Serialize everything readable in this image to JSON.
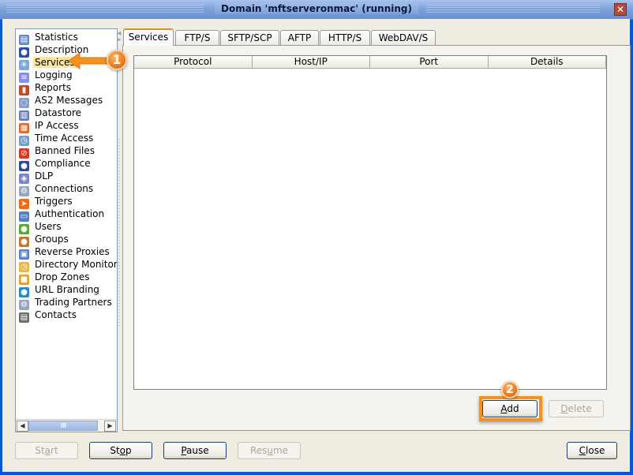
{
  "window": {
    "title": "Domain 'mftserveronmac' (running)",
    "close_icon": "close-icon"
  },
  "sidebar": {
    "selected": "Services",
    "items": [
      {
        "label": "Statistics",
        "icon": "statistics-icon"
      },
      {
        "label": "Description",
        "icon": "person-icon"
      },
      {
        "label": "Services",
        "icon": "services-icon"
      },
      {
        "label": "Logging",
        "icon": "speech-bubble-icon"
      },
      {
        "label": "Reports",
        "icon": "bar-chart-icon"
      },
      {
        "label": "AS2 Messages",
        "icon": "messages-icon"
      },
      {
        "label": "Datastore",
        "icon": "database-icon"
      },
      {
        "label": "IP Access",
        "icon": "firewall-icon"
      },
      {
        "label": "Time Access",
        "icon": "calendar-clock-icon"
      },
      {
        "label": "Banned Files",
        "icon": "banned-file-icon"
      },
      {
        "label": "Compliance",
        "icon": "officer-icon"
      },
      {
        "label": "DLP",
        "icon": "shield-icon"
      },
      {
        "label": "Connections",
        "icon": "gear-connections-icon"
      },
      {
        "label": "Triggers",
        "icon": "flame-arrow-icon"
      },
      {
        "label": "Authentication",
        "icon": "id-card-icon"
      },
      {
        "label": "Users",
        "icon": "user-icon"
      },
      {
        "label": "Groups",
        "icon": "group-icon"
      },
      {
        "label": "Reverse Proxies",
        "icon": "network-icon"
      },
      {
        "label": "Directory Monitors",
        "icon": "folder-clock-icon"
      },
      {
        "label": "Drop Zones",
        "icon": "box-icon"
      },
      {
        "label": "URL Branding",
        "icon": "globe-icon"
      },
      {
        "label": "Trading Partners",
        "icon": "gear-partners-icon"
      },
      {
        "label": "Contacts",
        "icon": "address-book-icon"
      }
    ]
  },
  "tabs": [
    {
      "label": "Services",
      "active": true
    },
    {
      "label": "FTP/S",
      "active": false
    },
    {
      "label": "SFTP/SCP",
      "active": false
    },
    {
      "label": "AFTP",
      "active": false
    },
    {
      "label": "HTTP/S",
      "active": false
    },
    {
      "label": "WebDAV/S",
      "active": false
    }
  ],
  "services_table": {
    "columns": [
      "Protocol",
      "Host/IP",
      "Port",
      "Details"
    ],
    "rows": []
  },
  "panel_buttons": {
    "add": {
      "pre": "",
      "mn": "A",
      "post": "dd",
      "enabled": true
    },
    "delete": {
      "pre": "",
      "mn": "D",
      "post": "elete",
      "enabled": false
    }
  },
  "footer_buttons": {
    "start": {
      "pre": "St",
      "mn": "a",
      "post": "rt",
      "enabled": false
    },
    "stop": {
      "pre": "St",
      "mn": "o",
      "post": "p",
      "enabled": true
    },
    "pause": {
      "pre": "",
      "mn": "P",
      "post": "ause",
      "enabled": true
    },
    "resume": {
      "pre": "Res",
      "mn": "u",
      "post": "me",
      "enabled": false
    },
    "close": {
      "pre": "",
      "mn": "C",
      "post": "lose",
      "enabled": true
    }
  },
  "annotations": {
    "step1": "1",
    "step2": "2",
    "accent_color": "#f5911f"
  },
  "scrollbar": {
    "thumb_grip": "IIIII"
  }
}
